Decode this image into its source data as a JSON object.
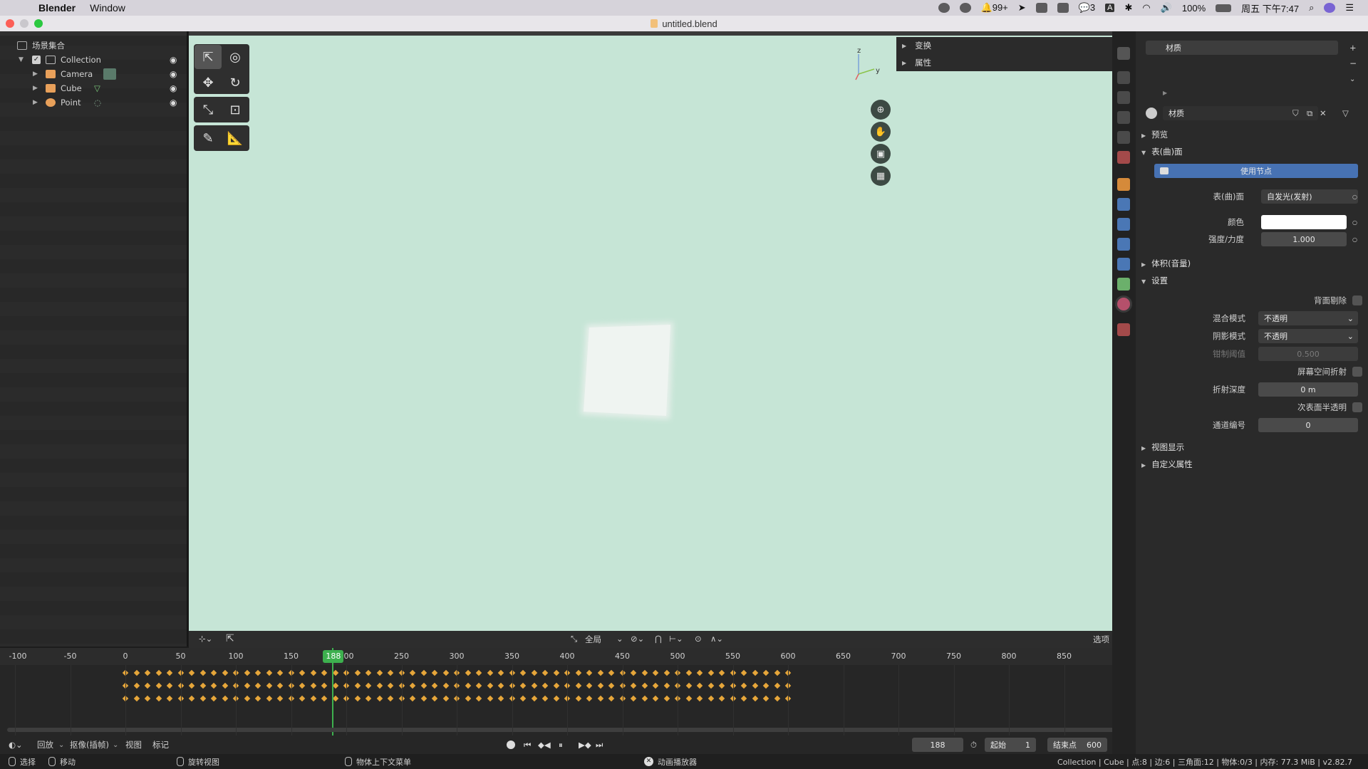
{
  "menubar": {
    "apple_glyph": "",
    "app_name": "Blender",
    "menus": [
      "Window"
    ],
    "notification_count": "99+",
    "wechat_count": "3",
    "ime_indicator": "A",
    "battery": "100%",
    "clock": "周五 下午7:47"
  },
  "window": {
    "title": "untitled.blend"
  },
  "outliner": {
    "scene_collection": "场景集合",
    "items": [
      {
        "label": "Collection",
        "type": "collection"
      },
      {
        "label": "Camera",
        "type": "camera"
      },
      {
        "label": "Cube",
        "type": "mesh"
      },
      {
        "label": "Point",
        "type": "light"
      }
    ],
    "eye_glyph": "◉"
  },
  "viewport": {
    "npanel_rows": [
      "变换",
      "属性"
    ],
    "axis_labels": {
      "z": "z",
      "y": "y"
    },
    "background_color": "#c6e5d6",
    "tools": [
      "select-box-icon",
      "cursor-icon",
      "move-icon",
      "rotate-icon",
      "scale-icon",
      "transform-icon",
      "annotate-icon",
      "measure-icon"
    ],
    "nav_buttons": [
      "zoom-icon",
      "pan-hand-icon",
      "camera-view-icon",
      "ortho-grid-icon"
    ]
  },
  "timeline_header": {
    "global_label": "全局",
    "options_label": "选项"
  },
  "timeline": {
    "ticks": [
      "-100",
      "-50",
      "0",
      "50",
      "100",
      "150",
      "200",
      "250",
      "300",
      "350",
      "400",
      "450",
      "500",
      "550",
      "600",
      "650",
      "700",
      "750",
      "800",
      "850"
    ],
    "current_frame": "188",
    "keyframe_rows": 3,
    "keyframe_start": 0,
    "keyframe_end": 600,
    "keyframe_step": 10,
    "keyframe_color": "#e6a63a",
    "playhead_color": "#3db04e"
  },
  "playback": {
    "menus": [
      "回放",
      "抠像(插帧)",
      "视图",
      "标记"
    ],
    "frame": "188",
    "start_label": "起始",
    "start_value": "1",
    "end_label": "结束点",
    "end_value": "600"
  },
  "properties": {
    "material_slot": "材质",
    "material_name": "材质",
    "sections": {
      "preview": "预览",
      "surface": "表(曲)面",
      "volume": "体积(音量)",
      "settings": "设置",
      "viewport_display": "视图显示",
      "custom_props": "自定义属性"
    },
    "use_nodes_button": "使用节点",
    "surface_label": "表(曲)面",
    "surface_value": "自发光(发射)",
    "color_label": "颜色",
    "color_value": "#ffffff",
    "strength_label": "强度/力度",
    "strength_value": "1.000",
    "backface_label": "背面剔除",
    "blend_mode_label": "混合模式",
    "blend_mode_value": "不透明",
    "shadow_mode_label": "阴影模式",
    "shadow_mode_value": "不透明",
    "clip_label": "钳制阈值",
    "clip_value": "0.500",
    "ssr_label": "屏幕空间折射",
    "refraction_depth_label": "折射深度",
    "refraction_depth_value": "0 m",
    "sss_label": "次表面半透明",
    "pass_index_label": "通道编号",
    "pass_index_value": "0"
  },
  "status": {
    "select": "选择",
    "move": "移动",
    "rotate_view": "旋转视图",
    "context_menu": "物体上下文菜单",
    "anim_player": "动画播放器",
    "stats": "Collection | Cube | 点:8 | 边:6 | 三角面:12 | 物体:0/3 | 内存: 77.3 MiB | v2.82.7"
  }
}
